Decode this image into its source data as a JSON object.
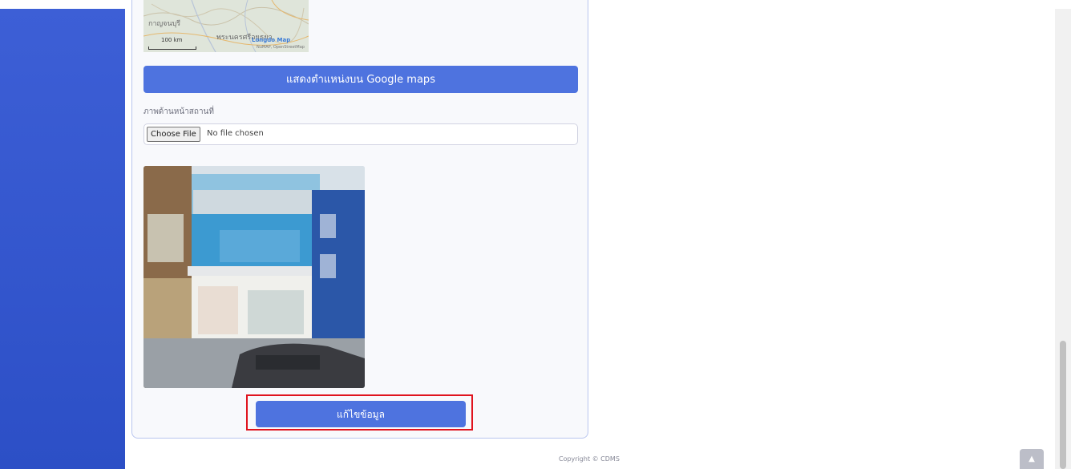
{
  "map": {
    "city_label_1": "กาญจนบุรี",
    "city_label_2": "พระนครศรีอยุธยา",
    "scale": "100 km",
    "brand": "Longdo Map",
    "attribution": "NuMAP, OpenStreetMap"
  },
  "buttons": {
    "show_map": "แสดงตำแหน่งบน Google maps",
    "edit": "แก้ไขข้อมูล"
  },
  "photo_field": {
    "label": "ภาพด้านหน้าสถานที่",
    "choose_button": "Choose File",
    "status": "No file chosen"
  },
  "footer": {
    "copyright": "Copyright © CDMS",
    "scroll_top_icon": "chevron-up-icon"
  },
  "colors": {
    "sidebar": "#2c4fc6",
    "primary": "#4e73df",
    "highlight": "#e0141e"
  }
}
